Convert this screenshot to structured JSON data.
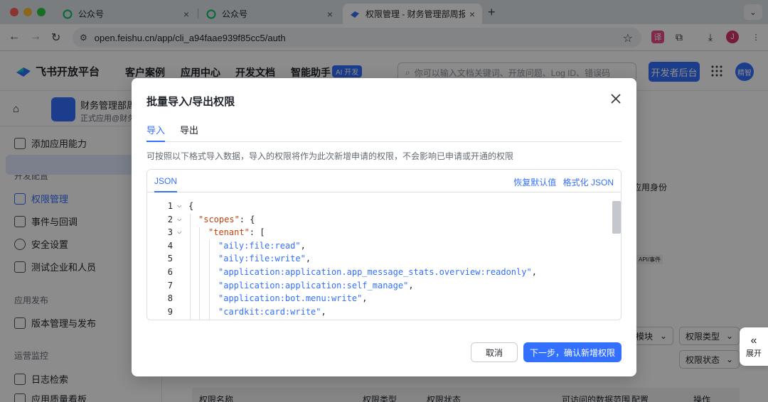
{
  "browser": {
    "tabs": [
      {
        "title": "公众号",
        "active": false
      },
      {
        "title": "公众号",
        "active": false
      },
      {
        "title": "权限管理 - 财务管理部周报整理",
        "active": true
      }
    ],
    "url": "open.feishu.cn/app/cli_a94faae939f85cc5/auth",
    "profile_initial": "J",
    "new_tab_symbol": "+"
  },
  "topnav": {
    "brand": "飞书开放平台",
    "links": [
      "客户案例",
      "应用中心",
      "开发文档",
      "智能助手"
    ],
    "ai_badge": "AI 开发",
    "search_placeholder": "你可以输入文档关键词、开放问题、Log ID、错误码",
    "dev_console": "开发者后台",
    "avatar_text": "精智"
  },
  "sidebar": {
    "app_name": "财务管理部周",
    "app_sub": "正式应用@财务",
    "add_capability": "添加应用能力",
    "sections": [
      {
        "title": "开发配置",
        "items": [
          "权限管理",
          "事件与回调",
          "安全设置",
          "测试企业和人员"
        ]
      },
      {
        "title": "应用发布",
        "items": [
          "版本管理与发布"
        ]
      },
      {
        "title": "运营监控",
        "items": [
          "日志检索",
          "应用质量看板"
        ]
      }
    ]
  },
  "background": {
    "identity_hint": "应用身份",
    "api_tag": "API/事件",
    "filters": [
      "模块",
      "权限类型",
      "权限状态"
    ],
    "table_headers": [
      "权限名称",
      "权限类型",
      "权限状态",
      "可访问的数据范围",
      "操作"
    ],
    "data_scope_config": "配置",
    "expand_label": "展开"
  },
  "modal": {
    "title": "批量导入/导出权限",
    "tabs": [
      "导入",
      "导出"
    ],
    "description": "可按照以下格式导入数据，导入的权限将作为此次新增申请的权限，不会影响已申请或开通的权限",
    "editor": {
      "tab": "JSON",
      "reset": "恢复默认值",
      "format": "格式化 JSON",
      "lines": [
        {
          "n": "1",
          "fold": true,
          "text": "{"
        },
        {
          "n": "2",
          "fold": true,
          "key": "\"scopes\"",
          "rest": ": {"
        },
        {
          "n": "3",
          "fold": true,
          "key": "\"tenant\"",
          "rest": ": ["
        },
        {
          "n": "4",
          "fold": false,
          "str": "\"aily:file:read\"",
          "rest": ","
        },
        {
          "n": "5",
          "fold": false,
          "str": "\"aily:file:write\"",
          "rest": ","
        },
        {
          "n": "6",
          "fold": false,
          "str": "\"application:application.app_message_stats.overview:readonly\"",
          "rest": ","
        },
        {
          "n": "7",
          "fold": false,
          "str": "\"application:application:self_manage\"",
          "rest": ","
        },
        {
          "n": "8",
          "fold": false,
          "str": "\"application:bot.menu:write\"",
          "rest": ","
        },
        {
          "n": "9",
          "fold": false,
          "str": "\"cardkit:card:write\"",
          "rest": ","
        }
      ]
    },
    "cancel": "取消",
    "confirm": "下一步，确认新增权限"
  }
}
